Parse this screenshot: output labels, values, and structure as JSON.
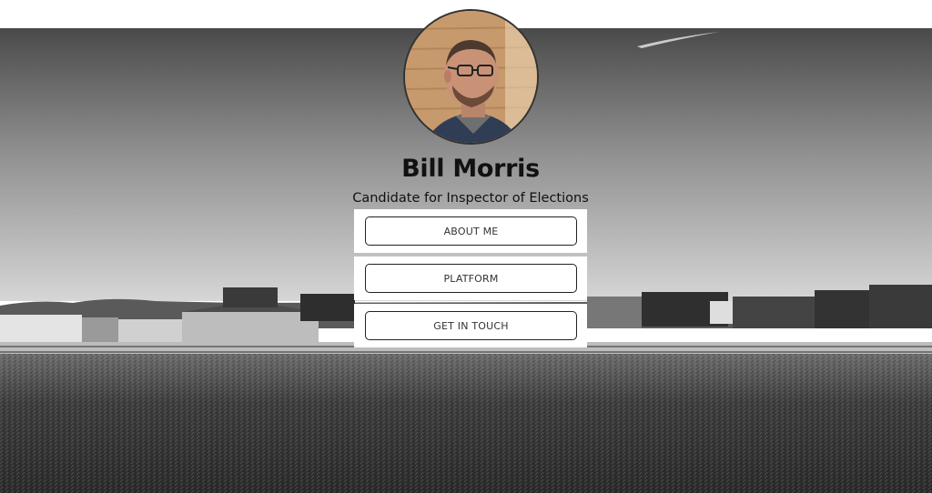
{
  "profile": {
    "name": "Bill Morris",
    "subtitle": "Candidate for Inspector of Elections"
  },
  "links": [
    {
      "label": "ABOUT ME"
    },
    {
      "label": "PLATFORM"
    },
    {
      "label": "GET IN TOUCH"
    }
  ],
  "colors": {
    "card_bg": "#ffffff",
    "button_border": "#222222",
    "text": "#111111"
  }
}
